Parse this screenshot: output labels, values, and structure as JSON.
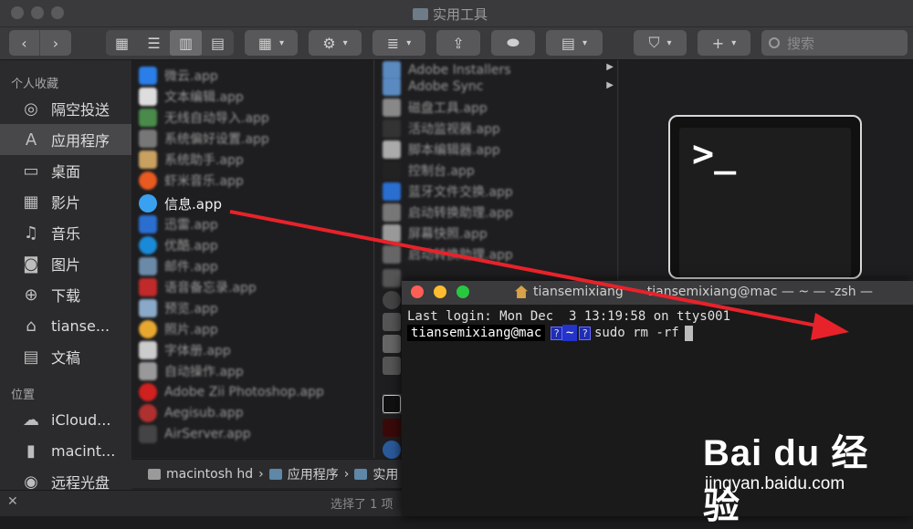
{
  "window": {
    "title": "实用工具"
  },
  "toolbar": {
    "search_placeholder": "搜索"
  },
  "sidebar": {
    "favorites_header": "个人收藏",
    "items": [
      {
        "label": "隔空投送",
        "icon": "airdrop-icon"
      },
      {
        "label": "应用程序",
        "icon": "applications-icon",
        "selected": true
      },
      {
        "label": "桌面",
        "icon": "desktop-icon"
      },
      {
        "label": "影片",
        "icon": "movies-icon"
      },
      {
        "label": "音乐",
        "icon": "music-icon"
      },
      {
        "label": "图片",
        "icon": "pictures-icon"
      },
      {
        "label": "下载",
        "icon": "downloads-icon"
      },
      {
        "label": "tianse...",
        "icon": "home-icon"
      },
      {
        "label": "文稿",
        "icon": "documents-icon"
      }
    ],
    "locations_header": "位置",
    "locations": [
      {
        "label": "iCloud...",
        "icon": "icloud-icon"
      },
      {
        "label": "macint...",
        "icon": "disk-icon"
      },
      {
        "label": "远程光盘",
        "icon": "optical-disc-icon"
      }
    ]
  },
  "column1": {
    "items": [
      {
        "label": "微云.app"
      },
      {
        "label": "文本编辑.app"
      },
      {
        "label": "无线自动导入.app"
      },
      {
        "label": "系统偏好设置.app"
      },
      {
        "label": "系统助手.app"
      },
      {
        "label": "虾米音乐.app"
      },
      {
        "label": "信息.app",
        "clear": true
      },
      {
        "label": "迅雷.app"
      },
      {
        "label": "优酷.app"
      },
      {
        "label": "邮件.app"
      },
      {
        "label": "语音备忘录.app"
      },
      {
        "label": "预览.app"
      },
      {
        "label": "照片.app"
      },
      {
        "label": "字体册.app"
      },
      {
        "label": "自动操作.app"
      },
      {
        "label": "Adobe Zii Photoshop.app"
      },
      {
        "label": "Aegisub.app"
      },
      {
        "label": "AirServer.app"
      }
    ]
  },
  "column2": {
    "items": [
      {
        "label": "Adobe Installers"
      },
      {
        "label": "Adobe Sync"
      },
      {
        "label": "磁盘工具.app"
      },
      {
        "label": "活动监视器.app"
      },
      {
        "label": "脚本编辑器.app"
      },
      {
        "label": "控制台.app"
      },
      {
        "label": "蓝牙文件交换.app"
      },
      {
        "label": "启动转换助理.app"
      },
      {
        "label": "屏幕快照.app"
      },
      {
        "label": "启动转换助理.app"
      }
    ]
  },
  "pathbar": {
    "segments": [
      "macintosh hd",
      "应用程序",
      "实用"
    ]
  },
  "statusbar": {
    "text": "选择了 1 项"
  },
  "terminal": {
    "title_user": "tiansemixiang",
    "title_rest": "tiansemixiang@mac — ~ — -zsh —",
    "last_login": "Last login: Mon Dec  3 13:19:58 on ttys001",
    "prompt_user": "tiansemixiang@mac",
    "prompt_q1": "?",
    "prompt_dir": "~",
    "prompt_q2": "?",
    "command": "sudo rm -rf"
  },
  "preview": {
    "icon_prompt": ">_"
  },
  "watermark": {
    "brand": "Bai du 经验",
    "url": "jingyan.baidu.com"
  },
  "colors": {
    "annotation_arrow": "#e8222a",
    "terminal_prompt_dir": "#2434c8",
    "finder_selection": "#48484a"
  }
}
